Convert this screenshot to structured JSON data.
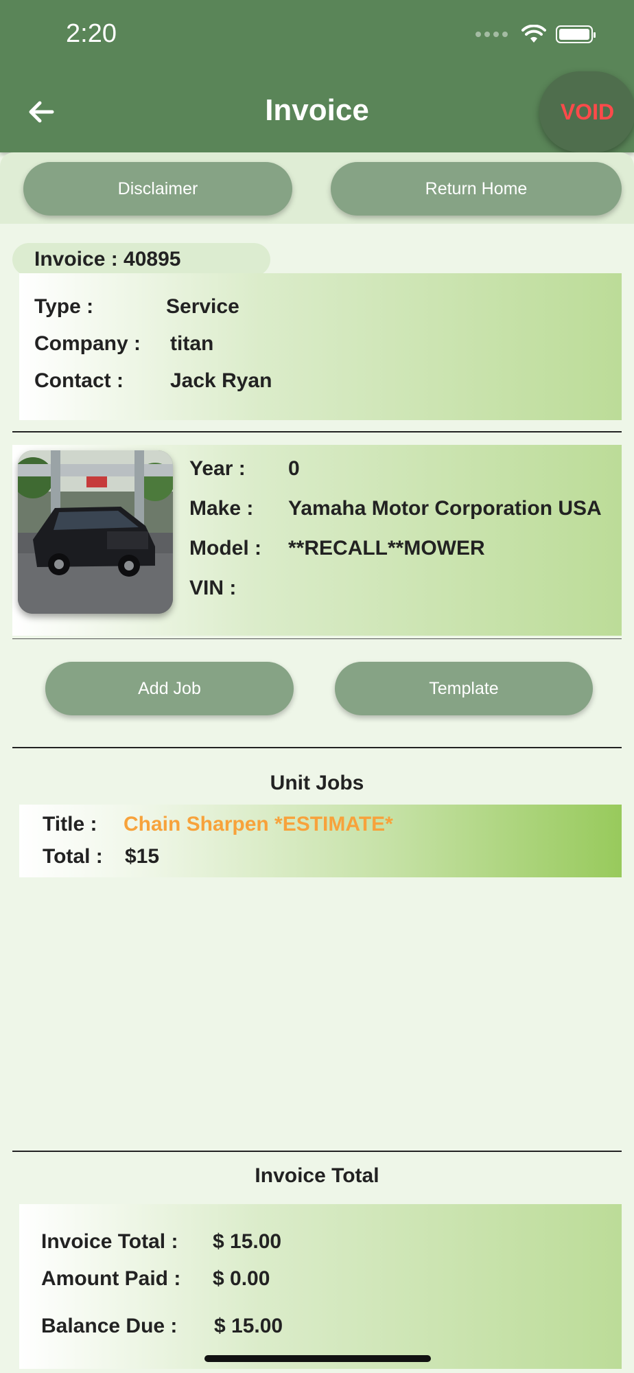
{
  "status_bar": {
    "time": "2:20"
  },
  "header": {
    "title": "Invoice",
    "void_label": "VOID"
  },
  "actions": {
    "disclaimer": "Disclaimer",
    "return_home": "Return Home"
  },
  "invoice": {
    "label": "Invoice : 40895",
    "type_label": "Type :",
    "type_value": "Service",
    "company_label": "Company :",
    "company_value": "titan",
    "contact_label": "Contact :",
    "contact_value": "Jack Ryan"
  },
  "unit": {
    "year_label": "Year :",
    "year_value": "0",
    "make_label": "Make :",
    "make_value": "Yamaha Motor Corporation USA",
    "model_label": "Model :",
    "model_value": "**RECALL**MOWER",
    "vin_label": "VIN :",
    "vin_value": ""
  },
  "job_actions": {
    "add_job": "Add Job",
    "template": "Template"
  },
  "unit_jobs": {
    "heading": "Unit Jobs",
    "items": [
      {
        "title_label": "Title :",
        "title": "Chain Sharpen  *ESTIMATE*",
        "total_label": "Total :",
        "total": "$15"
      }
    ]
  },
  "totals": {
    "heading": "Invoice Total",
    "invoice_total_label": "Invoice Total :",
    "invoice_total": "$ 15.00",
    "amount_paid_label": "Amount Paid :",
    "amount_paid": "$ 0.00",
    "balance_due_label": "Balance Due :",
    "balance_due": "$ 15.00"
  },
  "colors": {
    "header": "#5a8558",
    "button": "#86a385",
    "void_text": "#ff4a4a",
    "estimate_text": "#f7a23b"
  }
}
